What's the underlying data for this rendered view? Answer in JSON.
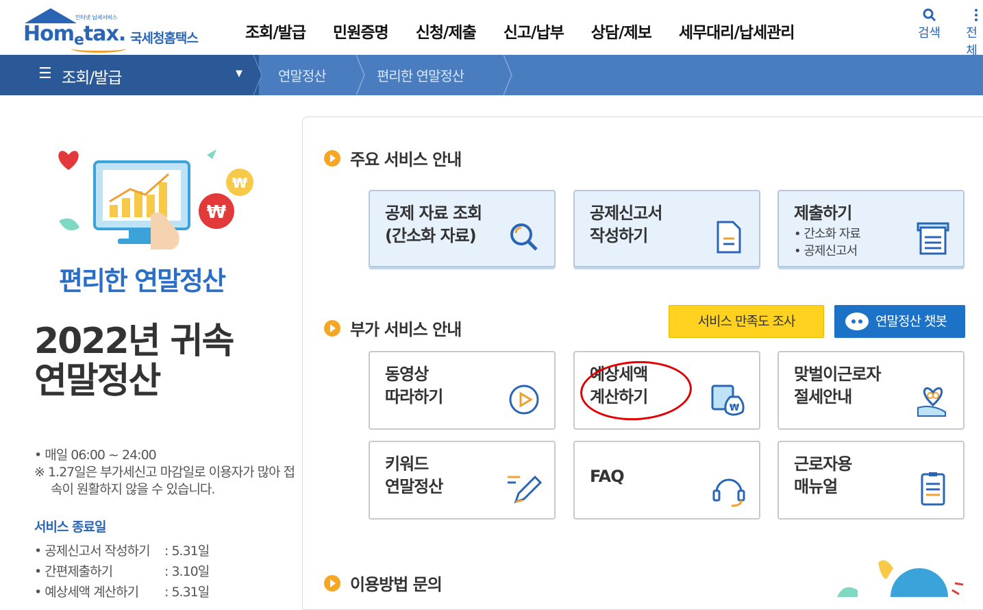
{
  "header": {
    "logo_small": "인터넷 납세서비스",
    "logo_main": "Hom",
    "logo_e": "e",
    "logo_tax": "tax.",
    "logo_sub": "국세청홈택스",
    "menu": [
      "조회/발급",
      "민원증명",
      "신청/제출",
      "신고/납부",
      "상담/제보",
      "세무대리/납세관리"
    ],
    "search_label": "검색",
    "all_label": "전체"
  },
  "navbar": {
    "menu_label": "조회/발급",
    "crumbs": [
      "연말정산",
      "편리한 연말정산"
    ]
  },
  "left": {
    "hero_title": "편리한 연말정산",
    "year_line1": "2022년 귀속",
    "year_line2": "연말정산",
    "hours": "• 매일 06:00  ~ 24:00",
    "notice": "※ 1.27일은 부가세신고 마감일로 이용자가 많아 접속이 원활하지 않을 수 있습니다.",
    "end_title": "서비스 종료일",
    "end_items": [
      {
        "k": "• 공제신고서 작성하기",
        "v": ": 5.31일"
      },
      {
        "k": "• 간편제출하기",
        "v": ": 3.10일"
      },
      {
        "k": "• 예상세액 계산하기",
        "v": ": 5.31일"
      }
    ]
  },
  "main": {
    "section1": "주요 서비스 안내",
    "section2": "부가 서비스 안내",
    "section3": "이용방법 문의",
    "btn_survey": "서비스 만족도 조사",
    "btn_chatbot": "연말정산 챗봇",
    "cards_main": [
      {
        "l1": "공제 자료 조회",
        "l2": "(간소화 자료)",
        "icon": "magnifier-icon"
      },
      {
        "l1": "공제신고서",
        "l2": "작성하기",
        "icon": "document-icon"
      },
      {
        "l1": "제출하기",
        "b1": "• 간소화 자료",
        "b2": "• 공제신고서",
        "icon": "submit-icon"
      }
    ],
    "cards_extra": [
      {
        "l1": "동영상",
        "l2": "따라하기",
        "icon": "play-icon"
      },
      {
        "l1": "예상세액",
        "l2": "계산하기",
        "icon": "money-bag-icon"
      },
      {
        "l1": "맞벌이근로자",
        "l2": "절세안내",
        "icon": "heart-hand-icon"
      },
      {
        "l1": "키워드",
        "l2": "연말정산",
        "icon": "pencil-icon"
      },
      {
        "l1": "FAQ",
        "l2": "",
        "icon": "headset-icon"
      },
      {
        "l1": "근로자용",
        "l2": "매뉴얼",
        "icon": "manual-icon"
      }
    ]
  },
  "colors": {
    "brand_blue": "#2a65b5",
    "nav_blue": "#4a7cc0",
    "nav_dark": "#2b5897",
    "accent_orange": "#f6a623",
    "yellow_button": "#ffd21f",
    "chatbot_blue": "#1c72c7",
    "annotation_red": "#e00000"
  }
}
